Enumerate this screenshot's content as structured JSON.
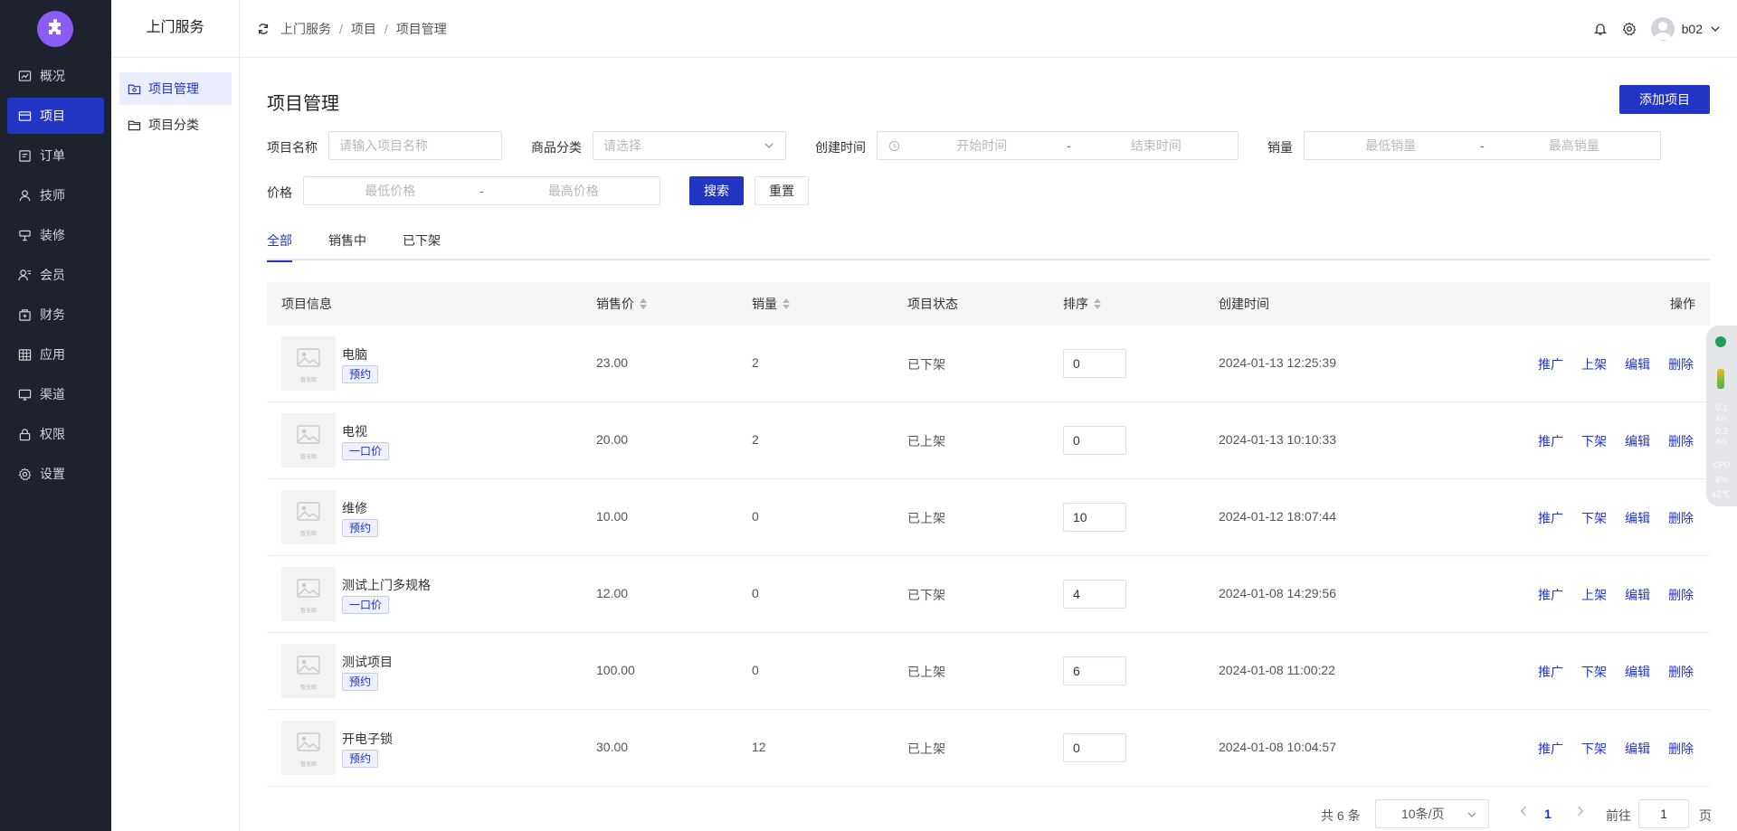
{
  "nav": {
    "items": [
      {
        "label": "概况",
        "icon": "chart-icon"
      },
      {
        "label": "项目",
        "icon": "card-icon"
      },
      {
        "label": "订单",
        "icon": "order-icon"
      },
      {
        "label": "技师",
        "icon": "person-icon"
      },
      {
        "label": "装修",
        "icon": "decorate-icon"
      },
      {
        "label": "会员",
        "icon": "member-icon"
      },
      {
        "label": "财务",
        "icon": "finance-icon"
      },
      {
        "label": "应用",
        "icon": "apps-icon"
      },
      {
        "label": "渠道",
        "icon": "channel-icon"
      },
      {
        "label": "权限",
        "icon": "lock-icon"
      },
      {
        "label": "设置",
        "icon": "gear-icon"
      }
    ],
    "active_index": 1
  },
  "subnav": {
    "title": "上门服务",
    "items": [
      {
        "label": "项目管理"
      },
      {
        "label": "项目分类"
      }
    ]
  },
  "header": {
    "breadcrumb": [
      "上门服务",
      "项目",
      "项目管理"
    ],
    "sep": "/",
    "username": "b02"
  },
  "page": {
    "title": "项目管理",
    "add_button": "添加项目"
  },
  "filters": {
    "name_label": "项目名称",
    "name_placeholder": "请输入项目名称",
    "category_label": "商品分类",
    "category_placeholder": "请选择",
    "created_label": "创建时间",
    "start_placeholder": "开始时间",
    "end_placeholder": "结束时间",
    "sales_label": "销量",
    "sales_min_placeholder": "最低销量",
    "sales_max_placeholder": "最高销量",
    "price_label": "价格",
    "price_min_placeholder": "最低价格",
    "price_max_placeholder": "最高价格",
    "range_dash": "-",
    "search_button": "搜索",
    "reset_button": "重置"
  },
  "tabs": [
    {
      "label": "全部"
    },
    {
      "label": "销售中"
    },
    {
      "label": "已下架"
    }
  ],
  "table": {
    "headers": {
      "info": "项目信息",
      "price": "销售价",
      "sales": "销量",
      "status": "项目状态",
      "sort": "排序",
      "created": "创建时间",
      "actions": "操作"
    },
    "thumb_text": "暂无图",
    "rows": [
      {
        "name": "电脑",
        "tag": "预约",
        "price": "23.00",
        "sales": "2",
        "status": "已下架",
        "sort": "0",
        "created": "2024-01-13 12:25:39",
        "ops": [
          "推广",
          "上架",
          "编辑",
          "删除"
        ]
      },
      {
        "name": "电视",
        "tag": "一口价",
        "price": "20.00",
        "sales": "2",
        "status": "已上架",
        "sort": "0",
        "created": "2024-01-13 10:10:33",
        "ops": [
          "推广",
          "下架",
          "编辑",
          "删除"
        ]
      },
      {
        "name": "维修",
        "tag": "预约",
        "price": "10.00",
        "sales": "0",
        "status": "已上架",
        "sort": "10",
        "created": "2024-01-12 18:07:44",
        "ops": [
          "推广",
          "下架",
          "编辑",
          "删除"
        ]
      },
      {
        "name": "测试上门多规格",
        "tag": "一口价",
        "price": "12.00",
        "sales": "0",
        "status": "已下架",
        "sort": "4",
        "created": "2024-01-08 14:29:56",
        "ops": [
          "推广",
          "上架",
          "编辑",
          "删除"
        ]
      },
      {
        "name": "测试项目",
        "tag": "预约",
        "price": "100.00",
        "sales": "0",
        "status": "已上架",
        "sort": "6",
        "created": "2024-01-08 11:00:22",
        "ops": [
          "推广",
          "下架",
          "编辑",
          "删除"
        ]
      },
      {
        "name": "开电子锁",
        "tag": "预约",
        "price": "30.00",
        "sales": "12",
        "status": "已上架",
        "sort": "0",
        "created": "2024-01-08 10:04:57",
        "ops": [
          "推广",
          "下架",
          "编辑",
          "删除"
        ]
      }
    ]
  },
  "pagination": {
    "total": "共 6 条",
    "page_size": "10条/页",
    "current": "1",
    "goto_label": "前往",
    "goto_value": "1",
    "page_suffix": "页"
  },
  "monitor": {
    "up": "0.1",
    "up_unit": "K/s",
    "down": "0.2",
    "down_unit": "K/s",
    "cpu_label": "CPU",
    "cpu": "4%",
    "temp": "42℃"
  },
  "colors": {
    "accent": "#2335c5",
    "sidebar": "#1d222e",
    "logo": "#8b5cf6"
  }
}
